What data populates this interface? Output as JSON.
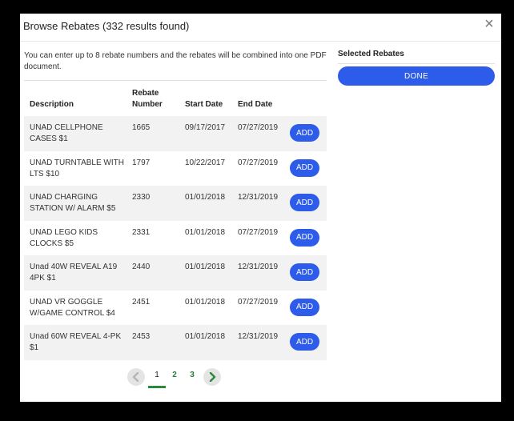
{
  "dialog": {
    "title": "Browse Rebates (332 results found)",
    "close_symbol": "×"
  },
  "intro": "You can enter up to 8 rebate numbers and the rebates will be combined into one PDF document.",
  "table": {
    "headers": {
      "description": "Description",
      "rebate_number": "Rebate Number",
      "start_date": "Start Date",
      "end_date": "End Date"
    },
    "add_label": "ADD",
    "rows": [
      {
        "description": "UNAD CELLPHONE CASES $1",
        "number": "1665",
        "start": "09/17/2017",
        "end": "07/27/2019"
      },
      {
        "description": "UNAD TURNTABLE WITH LTS $10",
        "number": "1797",
        "start": "10/22/2017",
        "end": "07/27/2019"
      },
      {
        "description": "UNAD CHARGING STATION W/ ALARM $5",
        "number": "2330",
        "start": "01/01/2018",
        "end": "12/31/2019"
      },
      {
        "description": "UNAD LEGO KIDS CLOCKS $5",
        "number": "2331",
        "start": "01/01/2018",
        "end": "07/27/2019"
      },
      {
        "description": "Unad 40W REVEAL A19 4PK $1",
        "number": "2440",
        "start": "01/01/2018",
        "end": "12/31/2019"
      },
      {
        "description": "UNAD VR GOGGLE W/GAME CONTROL $4",
        "number": "2451",
        "start": "01/01/2018",
        "end": "07/27/2019"
      },
      {
        "description": "Unad 60W REVEAL 4-PK $1",
        "number": "2453",
        "start": "01/01/2018",
        "end": "12/31/2019"
      }
    ]
  },
  "pagination": {
    "pages": [
      "1",
      "2",
      "3"
    ],
    "current": "1",
    "prev_icon": "chevron-left-icon",
    "next_icon": "chevron-right-icon"
  },
  "sidebar": {
    "title": "Selected Rebates",
    "done_label": "DONE"
  },
  "colors": {
    "accent": "#2d5bea",
    "pager_active": "#2a8a3a"
  }
}
